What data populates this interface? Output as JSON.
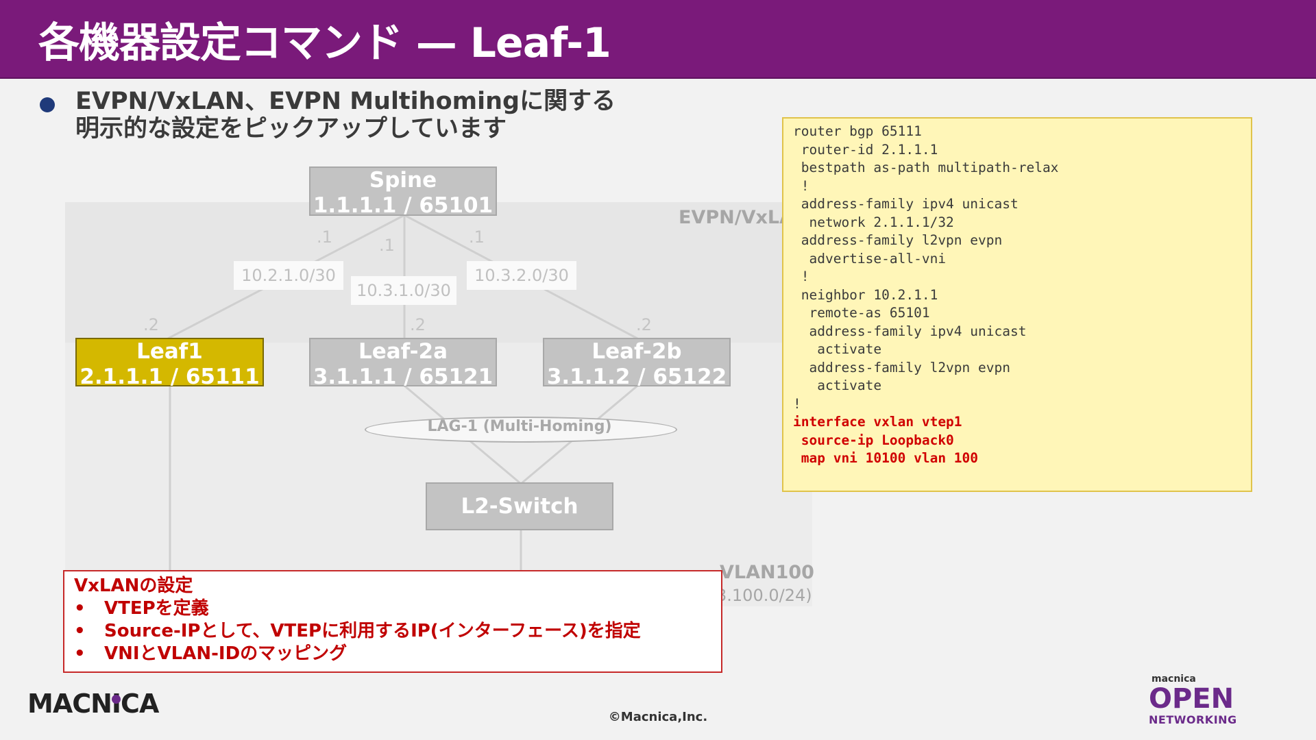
{
  "header": {
    "title": "各機器設定コマンド — Leaf-1"
  },
  "bullet": {
    "line1": "EVPN/VxLAN、EVPN Multihomingに関する",
    "line2": "明示的な設定をピックアップしています"
  },
  "diagram": {
    "evpn_label": "EVPN/VxLA",
    "vlan_label": "VLAN100",
    "vlan_subnet": "3.100.0/24)",
    "spine": {
      "name": "Spine",
      "addr": "1.1.1.1 / 65101"
    },
    "leaf1": {
      "name": "Leaf1",
      "addr": "2.1.1.1 / 65111"
    },
    "leaf2a": {
      "name": "Leaf-2a",
      "addr": "3.1.1.1 / 65121"
    },
    "leaf2b": {
      "name": "Leaf-2b",
      "addr": "3.1.1.2 / 65122"
    },
    "l2switch": {
      "name": "L2-Switch"
    },
    "subnets": [
      "10.2.1.0/30",
      "10.3.1.0/30",
      "10.3.2.0/30"
    ],
    "ip_tags": {
      "spine_left": ".1",
      "spine_mid": ".1",
      "spine_right": ".1",
      "leaf1": ".2",
      "leaf2a": ".2",
      "leaf2b": ".2"
    },
    "lag": "LAG-1 (Multi-Homing)"
  },
  "config": {
    "lines": [
      "router bgp 65111",
      " router-id 2.1.1.1",
      " bestpath as-path multipath-relax",
      " !",
      " address-family ipv4 unicast",
      "  network 2.1.1.1/32",
      " address-family l2vpn evpn",
      "  advertise-all-vni",
      " !",
      " neighbor 10.2.1.1",
      "  remote-as 65101",
      "  address-family ipv4 unicast",
      "   activate",
      "  address-family l2vpn evpn",
      "   activate",
      "!"
    ],
    "highlight_lines": [
      "interface vxlan vtep1",
      " source-ip Loopback0",
      " map vni 10100 vlan 100"
    ]
  },
  "note": {
    "title": "VxLANの設定",
    "bullet_mark": "•",
    "items": [
      "VTEPを定義",
      "Source-IPとして、VTEPに利用するIP(インターフェース)を指定",
      "VNIとVLAN-IDのマッピング"
    ]
  },
  "footer": {
    "logo_left": "MACNICA",
    "copyright": "©Macnica,Inc.",
    "logo_right_small": "macnica",
    "logo_right_big": "OPEN",
    "logo_right_sub": "NETWORKING"
  },
  "colors": {
    "header": "#7a1a7a",
    "leaf1": "#d4b800",
    "highlight": "#d00000",
    "code_bg": "#fff6b8"
  }
}
